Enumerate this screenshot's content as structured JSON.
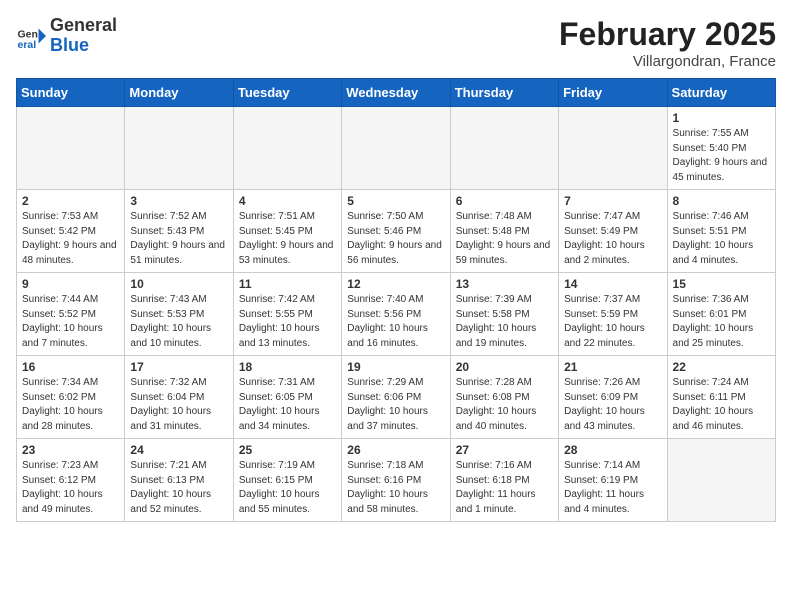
{
  "header": {
    "logo_general": "General",
    "logo_blue": "Blue",
    "month_title": "February 2025",
    "location": "Villargondran, France"
  },
  "weekdays": [
    "Sunday",
    "Monday",
    "Tuesday",
    "Wednesday",
    "Thursday",
    "Friday",
    "Saturday"
  ],
  "weeks": [
    [
      {
        "day": "",
        "info": ""
      },
      {
        "day": "",
        "info": ""
      },
      {
        "day": "",
        "info": ""
      },
      {
        "day": "",
        "info": ""
      },
      {
        "day": "",
        "info": ""
      },
      {
        "day": "",
        "info": ""
      },
      {
        "day": "1",
        "info": "Sunrise: 7:55 AM\nSunset: 5:40 PM\nDaylight: 9 hours and 45 minutes."
      }
    ],
    [
      {
        "day": "2",
        "info": "Sunrise: 7:53 AM\nSunset: 5:42 PM\nDaylight: 9 hours and 48 minutes."
      },
      {
        "day": "3",
        "info": "Sunrise: 7:52 AM\nSunset: 5:43 PM\nDaylight: 9 hours and 51 minutes."
      },
      {
        "day": "4",
        "info": "Sunrise: 7:51 AM\nSunset: 5:45 PM\nDaylight: 9 hours and 53 minutes."
      },
      {
        "day": "5",
        "info": "Sunrise: 7:50 AM\nSunset: 5:46 PM\nDaylight: 9 hours and 56 minutes."
      },
      {
        "day": "6",
        "info": "Sunrise: 7:48 AM\nSunset: 5:48 PM\nDaylight: 9 hours and 59 minutes."
      },
      {
        "day": "7",
        "info": "Sunrise: 7:47 AM\nSunset: 5:49 PM\nDaylight: 10 hours and 2 minutes."
      },
      {
        "day": "8",
        "info": "Sunrise: 7:46 AM\nSunset: 5:51 PM\nDaylight: 10 hours and 4 minutes."
      }
    ],
    [
      {
        "day": "9",
        "info": "Sunrise: 7:44 AM\nSunset: 5:52 PM\nDaylight: 10 hours and 7 minutes."
      },
      {
        "day": "10",
        "info": "Sunrise: 7:43 AM\nSunset: 5:53 PM\nDaylight: 10 hours and 10 minutes."
      },
      {
        "day": "11",
        "info": "Sunrise: 7:42 AM\nSunset: 5:55 PM\nDaylight: 10 hours and 13 minutes."
      },
      {
        "day": "12",
        "info": "Sunrise: 7:40 AM\nSunset: 5:56 PM\nDaylight: 10 hours and 16 minutes."
      },
      {
        "day": "13",
        "info": "Sunrise: 7:39 AM\nSunset: 5:58 PM\nDaylight: 10 hours and 19 minutes."
      },
      {
        "day": "14",
        "info": "Sunrise: 7:37 AM\nSunset: 5:59 PM\nDaylight: 10 hours and 22 minutes."
      },
      {
        "day": "15",
        "info": "Sunrise: 7:36 AM\nSunset: 6:01 PM\nDaylight: 10 hours and 25 minutes."
      }
    ],
    [
      {
        "day": "16",
        "info": "Sunrise: 7:34 AM\nSunset: 6:02 PM\nDaylight: 10 hours and 28 minutes."
      },
      {
        "day": "17",
        "info": "Sunrise: 7:32 AM\nSunset: 6:04 PM\nDaylight: 10 hours and 31 minutes."
      },
      {
        "day": "18",
        "info": "Sunrise: 7:31 AM\nSunset: 6:05 PM\nDaylight: 10 hours and 34 minutes."
      },
      {
        "day": "19",
        "info": "Sunrise: 7:29 AM\nSunset: 6:06 PM\nDaylight: 10 hours and 37 minutes."
      },
      {
        "day": "20",
        "info": "Sunrise: 7:28 AM\nSunset: 6:08 PM\nDaylight: 10 hours and 40 minutes."
      },
      {
        "day": "21",
        "info": "Sunrise: 7:26 AM\nSunset: 6:09 PM\nDaylight: 10 hours and 43 minutes."
      },
      {
        "day": "22",
        "info": "Sunrise: 7:24 AM\nSunset: 6:11 PM\nDaylight: 10 hours and 46 minutes."
      }
    ],
    [
      {
        "day": "23",
        "info": "Sunrise: 7:23 AM\nSunset: 6:12 PM\nDaylight: 10 hours and 49 minutes."
      },
      {
        "day": "24",
        "info": "Sunrise: 7:21 AM\nSunset: 6:13 PM\nDaylight: 10 hours and 52 minutes."
      },
      {
        "day": "25",
        "info": "Sunrise: 7:19 AM\nSunset: 6:15 PM\nDaylight: 10 hours and 55 minutes."
      },
      {
        "day": "26",
        "info": "Sunrise: 7:18 AM\nSunset: 6:16 PM\nDaylight: 10 hours and 58 minutes."
      },
      {
        "day": "27",
        "info": "Sunrise: 7:16 AM\nSunset: 6:18 PM\nDaylight: 11 hours and 1 minute."
      },
      {
        "day": "28",
        "info": "Sunrise: 7:14 AM\nSunset: 6:19 PM\nDaylight: 11 hours and 4 minutes."
      },
      {
        "day": "",
        "info": ""
      }
    ]
  ]
}
